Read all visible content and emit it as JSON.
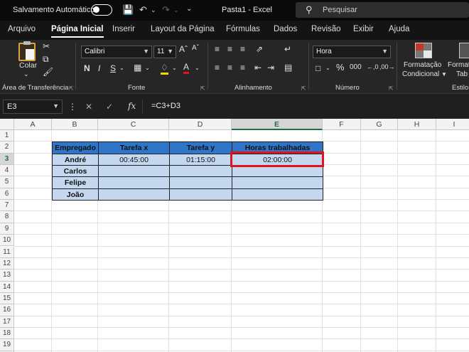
{
  "titlebar": {
    "autosave_label": "Salvamento Automático",
    "doc_title": "Pasta1  -  Excel",
    "search_placeholder": "Pesquisar"
  },
  "tabs": [
    "Arquivo",
    "Página Inicial",
    "Inserir",
    "Layout da Página",
    "Fórmulas",
    "Dados",
    "Revisão",
    "Exibir",
    "Ajuda"
  ],
  "active_tab": "Página Inicial",
  "ribbon": {
    "paste_label": "Colar",
    "font_name": "Calibri",
    "font_size": "11",
    "number_format": "Hora",
    "groups": {
      "clipboard": "Área de Transferência",
      "font": "Fonte",
      "alignment": "Alinhamento",
      "number": "Número",
      "styles": "Estilo"
    },
    "conditional_line1": "Formatação",
    "conditional_line2": "Condicional",
    "table_line1": "Format",
    "table_line2": "Tab"
  },
  "formula_bar": {
    "name_box": "E3",
    "formula": "=C3+D3"
  },
  "sheet": {
    "columns": [
      "A",
      "B",
      "C",
      "D",
      "E",
      "F",
      "G",
      "H",
      "I"
    ],
    "selected_column": "E",
    "rows": [
      "1",
      "2",
      "3",
      "4",
      "5",
      "6",
      "7",
      "8",
      "9",
      "10",
      "11",
      "12",
      "13",
      "14",
      "15",
      "16",
      "17",
      "18",
      "19",
      "20"
    ],
    "selected_row": "3",
    "table": {
      "headers": [
        "Empregado",
        "Tarefa x",
        "Tarefa y",
        "Horas trabalhadas"
      ],
      "rows": [
        [
          "André",
          "00:45:00",
          "01:15:00",
          "02:00:00"
        ],
        [
          "Carlos",
          "",
          "",
          ""
        ],
        [
          "Felipe",
          "",
          "",
          ""
        ],
        [
          "João",
          "",
          "",
          ""
        ]
      ]
    }
  },
  "colors": {
    "header_fill": "#2f75c8",
    "body_fill": "#c4d9ef",
    "highlight": "#e0141e",
    "selection": "#1e7145"
  }
}
